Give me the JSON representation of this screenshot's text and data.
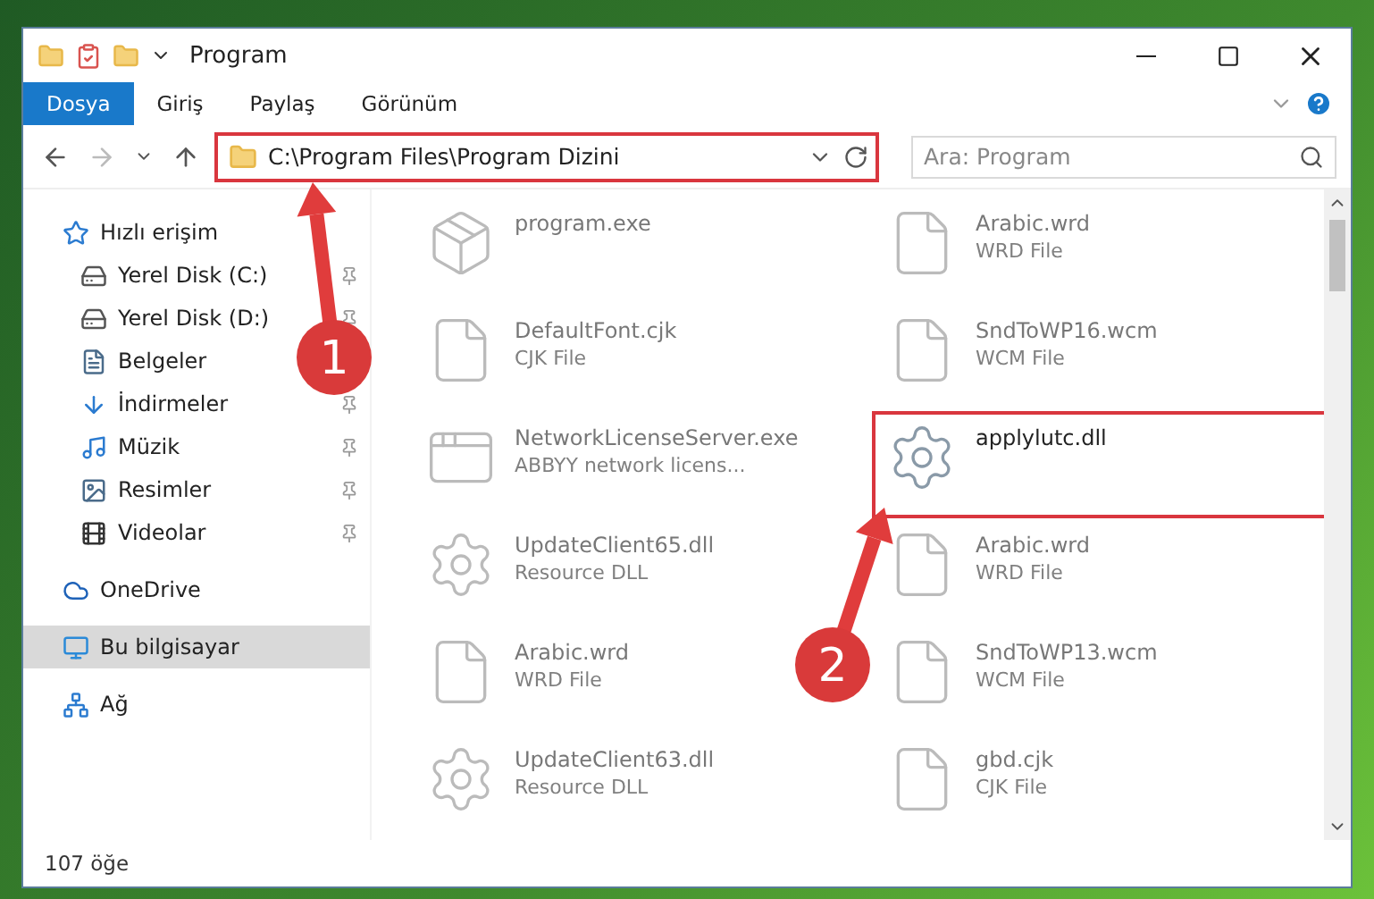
{
  "window": {
    "title": "Program"
  },
  "ribbon_tabs": [
    {
      "label": "Dosya",
      "selected": true
    },
    {
      "label": "Giriş",
      "selected": false
    },
    {
      "label": "Paylaş",
      "selected": false
    },
    {
      "label": "Görünüm",
      "selected": false
    }
  ],
  "address_bar": {
    "path": "C:\\Program Files\\Program Dizini",
    "highlighted": true
  },
  "search": {
    "placeholder": "Ara: Program"
  },
  "sidebar": {
    "items": [
      {
        "label": "Hızlı erişim",
        "kind": "star",
        "selected": false,
        "children": [
          {
            "label": "Yerel Disk (C:)",
            "kind": "drive",
            "pinned": true,
            "selected": false
          },
          {
            "label": "Yerel Disk (D:)",
            "kind": "drive",
            "pinned": true,
            "selected": false
          },
          {
            "label": "Belgeler",
            "kind": "document",
            "selected": false
          },
          {
            "label": "İndirmeler",
            "kind": "download",
            "pinned": true,
            "selected": false
          },
          {
            "label": "Müzik",
            "kind": "music",
            "pinned": true,
            "selected": false
          },
          {
            "label": "Resimler",
            "kind": "pictures",
            "pinned": true,
            "selected": false
          },
          {
            "label": "Videolar",
            "kind": "videos",
            "pinned": true,
            "selected": false
          }
        ]
      },
      {
        "label": "OneDrive",
        "kind": "cloud",
        "selected": false
      },
      {
        "label": "Bu bilgisayar",
        "kind": "computer",
        "selected": true
      },
      {
        "label": "Ağ",
        "kind": "network",
        "selected": false
      }
    ]
  },
  "files": [
    {
      "name": "program.exe",
      "kind": "app",
      "faded": true,
      "highlighted": false
    },
    {
      "name": "Arabic.wrd",
      "type": "WRD File",
      "kind": "blank",
      "faded": true,
      "highlighted": false
    },
    {
      "name": "DefaultFont.cjk",
      "type": "CJK File",
      "kind": "blank",
      "faded": true,
      "highlighted": false
    },
    {
      "name": "SndToWP16.wcm",
      "type": "WCM File",
      "kind": "blank",
      "faded": true,
      "highlighted": false
    },
    {
      "name": "NetworkLicenseServer.exe",
      "type": "ABBYY network licens...",
      "kind": "window",
      "faded": true,
      "highlighted": false
    },
    {
      "name": "applylutc.dll",
      "kind": "gear",
      "faded": false,
      "highlighted": true
    },
    {
      "name": "UpdateClient65.dll",
      "type": "Resource DLL",
      "kind": "gear",
      "faded": true,
      "highlighted": false
    },
    {
      "name": "Arabic.wrd",
      "type": "WRD File",
      "kind": "blank",
      "faded": true,
      "highlighted": false
    },
    {
      "name": "Arabic.wrd",
      "type": "WRD File",
      "kind": "blank",
      "faded": true,
      "highlighted": false
    },
    {
      "name": "SndToWP13.wcm",
      "type": "WCM File",
      "kind": "blank",
      "faded": true,
      "highlighted": false
    },
    {
      "name": "UpdateClient63.dll",
      "type": "Resource DLL",
      "kind": "gear",
      "faded": true,
      "highlighted": false
    },
    {
      "name": "gbd.cjk",
      "type": "CJK File",
      "kind": "blank",
      "faded": true,
      "highlighted": false
    }
  ],
  "status_bar": {
    "count": "107 öğe"
  },
  "annotations": [
    {
      "label": "1"
    },
    {
      "label": "2"
    }
  ]
}
